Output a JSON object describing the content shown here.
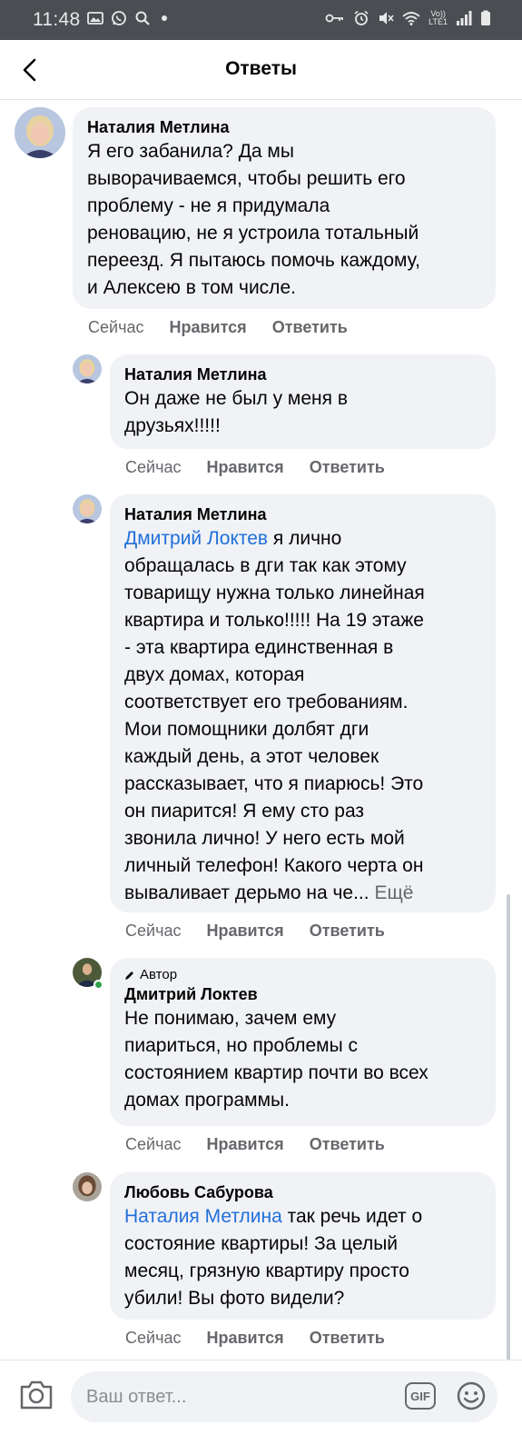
{
  "status_bar": {
    "time": "11:48",
    "left_icons": [
      "gallery-icon",
      "whatsapp-icon",
      "search-icon"
    ],
    "right_icons": [
      "key-icon",
      "alarm-icon",
      "mute-icon",
      "wifi-icon",
      "signal-icon",
      "battery-icon"
    ],
    "network": "Vo))\nLTE1"
  },
  "header": {
    "title": "Ответы",
    "back_icon": "chevron-left-icon"
  },
  "comments": [
    {
      "name": "Наталия Метлина",
      "text": "Я его забанила? Да мы\nвыворачиваемся, чтобы решить его\nпроблему - не я придумала\nреновацию, не я устроила тотальный\nпереезд. Я пытаюсь помочь каждому,\nи Алексею в том числе.",
      "time": "Сейчас",
      "like": "Нравится",
      "reply": "Ответить"
    },
    {
      "name": "Наталия Метлина",
      "text": "Он даже не был у меня в\nдрузьях!!!!!",
      "time": "Сейчас",
      "like": "Нравится",
      "reply": "Ответить"
    },
    {
      "name": "Наталия Метлина",
      "mention": "Дмитрий Локтев",
      "text_first": " я лично",
      "text": "обращалась в дги так как этому\nтоварищу нужна только линейная\nквартира и только!!!!! На 19 этаже\n- эта квартира единственная в\nдвух домах, которая\nсоответствует его требованиям.\nМои помощники долбят дги\nкаждый день, а этот человек\nрассказывает, что я пиарюсь! Это\nон пиарится! Я ему сто раз\nзвонила лично! У него есть мой\nличный телефон! Какого черта он\nвываливает дерьмо на че...",
      "more": " Ещё",
      "time": "Сейчас",
      "like": "Нравится",
      "reply": "Ответить"
    },
    {
      "badge": "Автор",
      "name": "Дмитрий Локтев",
      "text": "Не понимаю, зачем ему\nпиариться, но проблемы с\nсостоянием квартир почти во всех\nдомах программы.",
      "time": "Сейчас",
      "like": "Нравится",
      "reply": "Ответить"
    },
    {
      "name": "Любовь Сабурова",
      "mention": "Наталия Метлина",
      "text_first": " так речь идет о",
      "text": "состояние квартиры! За целый\nмесяц, грязную квартиру просто\nубили! Вы фото видели?",
      "time": "Сейчас",
      "like": "Нравится",
      "reply": "Ответить"
    }
  ],
  "composer": {
    "placeholder": "Ваш ответ...",
    "gif_label": "GIF",
    "camera_icon": "camera-icon",
    "emoji_icon": "emoji-icon"
  },
  "colors": {
    "bubble": "#f0f2f5",
    "mention": "#216fdb",
    "meta": "#65676b",
    "status_bar": "#4a4d52"
  }
}
